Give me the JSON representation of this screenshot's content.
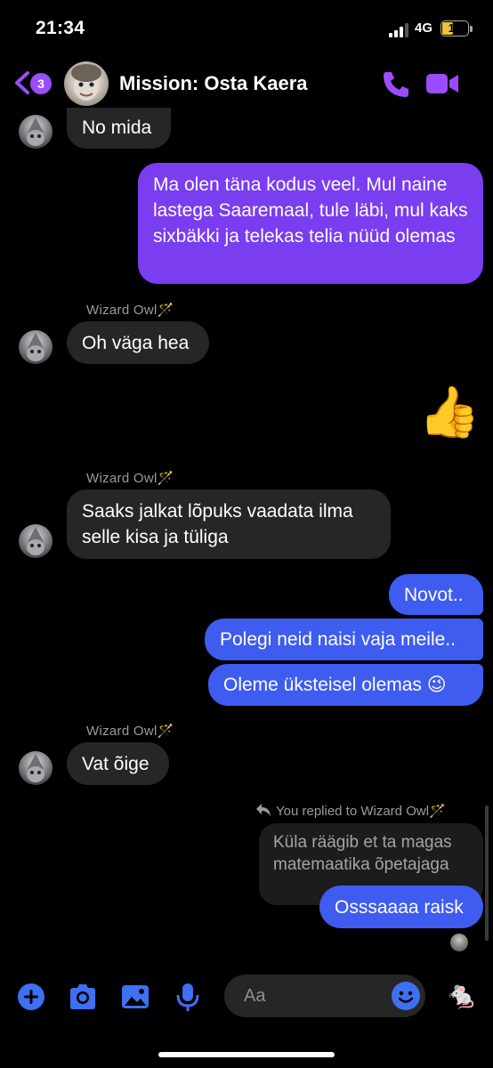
{
  "status": {
    "time": "21:34",
    "network": "4G",
    "battery": "15"
  },
  "header": {
    "back_count": "3",
    "title": "Mission: Osta Kaera"
  },
  "messages": {
    "m1": "No mida",
    "m2": "Ma olen täna kodus veel. Mul naine lastega Saaremaal, tule läbi, mul kaks sixbäkki ja telekas telia nüüd olemas",
    "sender1": "Wizard Owl🪄",
    "m3": "Oh väga hea",
    "reaction": "👍",
    "sender2": "Wizard Owl🪄",
    "m4": "Saaks jalkat lõpuks vaadata ilma selle kisa ja tüliga",
    "m5": "Novot..",
    "m6": "Polegi neid naisi vaja meile..",
    "m7": "Oleme üksteisel olemas 😉",
    "sender3": "Wizard Owl🪄",
    "m8": "Vat õige",
    "reply_note": "You replied to Wizard Owl🪄",
    "quoted": "Küla räägib et ta magas matemaatika õpetajaga",
    "m9": "Osssaaaa raisk"
  },
  "composer": {
    "placeholder": "Aa",
    "like_sticker": "🐁"
  },
  "colors": {
    "accent": "#9a4dff",
    "bubble_purple": "#7a3df0",
    "bubble_blue": "#3f5cf0",
    "bubble_incoming": "#262626"
  }
}
